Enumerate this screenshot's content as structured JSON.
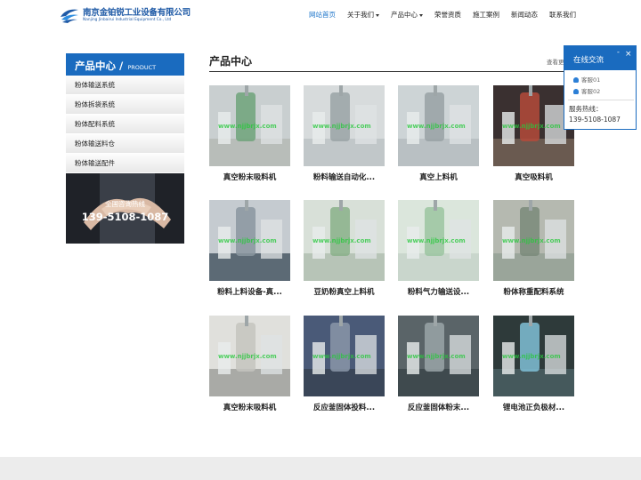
{
  "header": {
    "company_cn": "南京金铂锐工业设备有限公司",
    "company_en": "Nanjing Jinbairui Industrial Equipment Co., Ltd"
  },
  "nav": [
    {
      "label": "网站首页",
      "active": true,
      "dropdown": false
    },
    {
      "label": "关于我们",
      "active": false,
      "dropdown": true
    },
    {
      "label": "产品中心",
      "active": false,
      "dropdown": true
    },
    {
      "label": "荣誉资质",
      "active": false,
      "dropdown": false
    },
    {
      "label": "施工案例",
      "active": false,
      "dropdown": false
    },
    {
      "label": "新闻动态",
      "active": false,
      "dropdown": false
    },
    {
      "label": "联系我们",
      "active": false,
      "dropdown": false
    }
  ],
  "sidebar": {
    "title_cn": "产品中心 /",
    "title_en": "PRODUCT",
    "items": [
      "粉体输送系统",
      "粉体拆袋系统",
      "粉体配料系统",
      "粉体输送料仓",
      "粉体输送配件"
    ],
    "contact_label": "全国咨询热线",
    "contact_phone": "139-5108-1087"
  },
  "main": {
    "title": "产品中心",
    "more": "查看更多"
  },
  "products": [
    {
      "name": "真空粉末吸料机",
      "watermark": "www.njjbrjx.com"
    },
    {
      "name": "粉料输送自动化...",
      "watermark": "www.njjbrjx.com"
    },
    {
      "name": "真空上料机",
      "watermark": "www.njjbrjx.com"
    },
    {
      "name": "真空吸料机",
      "watermark": "www.njjbrjx.com"
    },
    {
      "name": "粉料上料设备-真...",
      "watermark": "www.njjbrjx.com"
    },
    {
      "name": "豆奶粉真空上料机",
      "watermark": "www.njjbrjx.com"
    },
    {
      "name": "粉料气力输送设...",
      "watermark": "www.njjbrjx.com"
    },
    {
      "name": "粉体称重配料系统",
      "watermark": "www.njjbrjx.com"
    },
    {
      "name": "真空粉末吸料机",
      "watermark": "www.njjbrjx.com"
    },
    {
      "name": "反应釜固体投料...",
      "watermark": "www.njjbrjx.com"
    },
    {
      "name": "反应釜固体粉末...",
      "watermark": "www.njjbrjx.com"
    },
    {
      "name": "锂电池正负极材...",
      "watermark": "www.njjbrjx.com"
    }
  ],
  "chat": {
    "title": "在线交流",
    "minimize": "-",
    "close": "×",
    "services": [
      "客服01",
      "客服02"
    ],
    "hotline_label": "服务热线：",
    "hotline": "139-5108-1087"
  },
  "colors": {
    "brand": "#1a6bbf",
    "nav_active": "#1a73c9"
  }
}
